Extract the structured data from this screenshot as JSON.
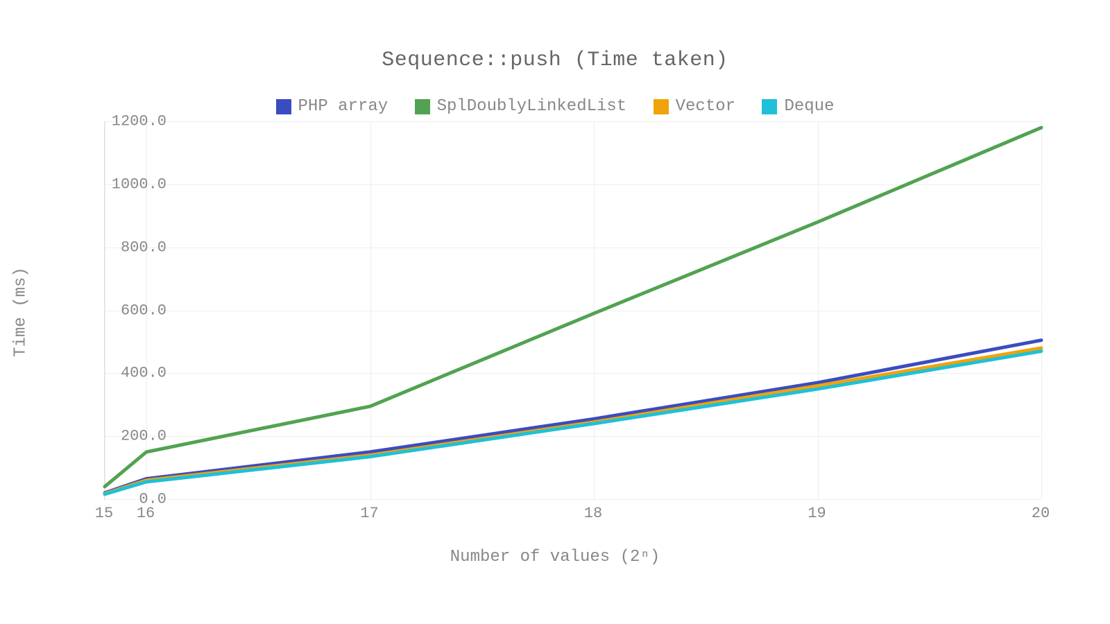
{
  "chart_data": {
    "type": "line",
    "title": "Sequence::push (Time taken)",
    "xlabel": "Number of values (2ⁿ)",
    "ylabel": "Time (ms)",
    "ylim": [
      0,
      1200
    ],
    "y_ticks": [
      0.0,
      200.0,
      400.0,
      600.0,
      800.0,
      1000.0,
      1200.0
    ],
    "y_tick_labels": [
      "0.0",
      "200.0",
      "400.0",
      "600.0",
      "800.0",
      "1000.0",
      "1200.0"
    ],
    "x": [
      15,
      16,
      17,
      18,
      19,
      20
    ],
    "x_tick_labels": [
      "15",
      "16",
      "17",
      "18",
      "19",
      "20"
    ],
    "series": [
      {
        "name": "PHP array",
        "color": "#3b4cc0",
        "values": [
          20,
          65,
          150,
          255,
          370,
          505
        ]
      },
      {
        "name": "SplDoublyLinkedList",
        "color": "#51a351",
        "values": [
          40,
          150,
          295,
          590,
          880,
          1180
        ]
      },
      {
        "name": "Vector",
        "color": "#f0a30a",
        "values": [
          18,
          60,
          140,
          245,
          360,
          480
        ]
      },
      {
        "name": "Deque",
        "color": "#1fc0d8",
        "values": [
          16,
          55,
          135,
          240,
          350,
          470
        ]
      }
    ],
    "legend_position": "top"
  }
}
